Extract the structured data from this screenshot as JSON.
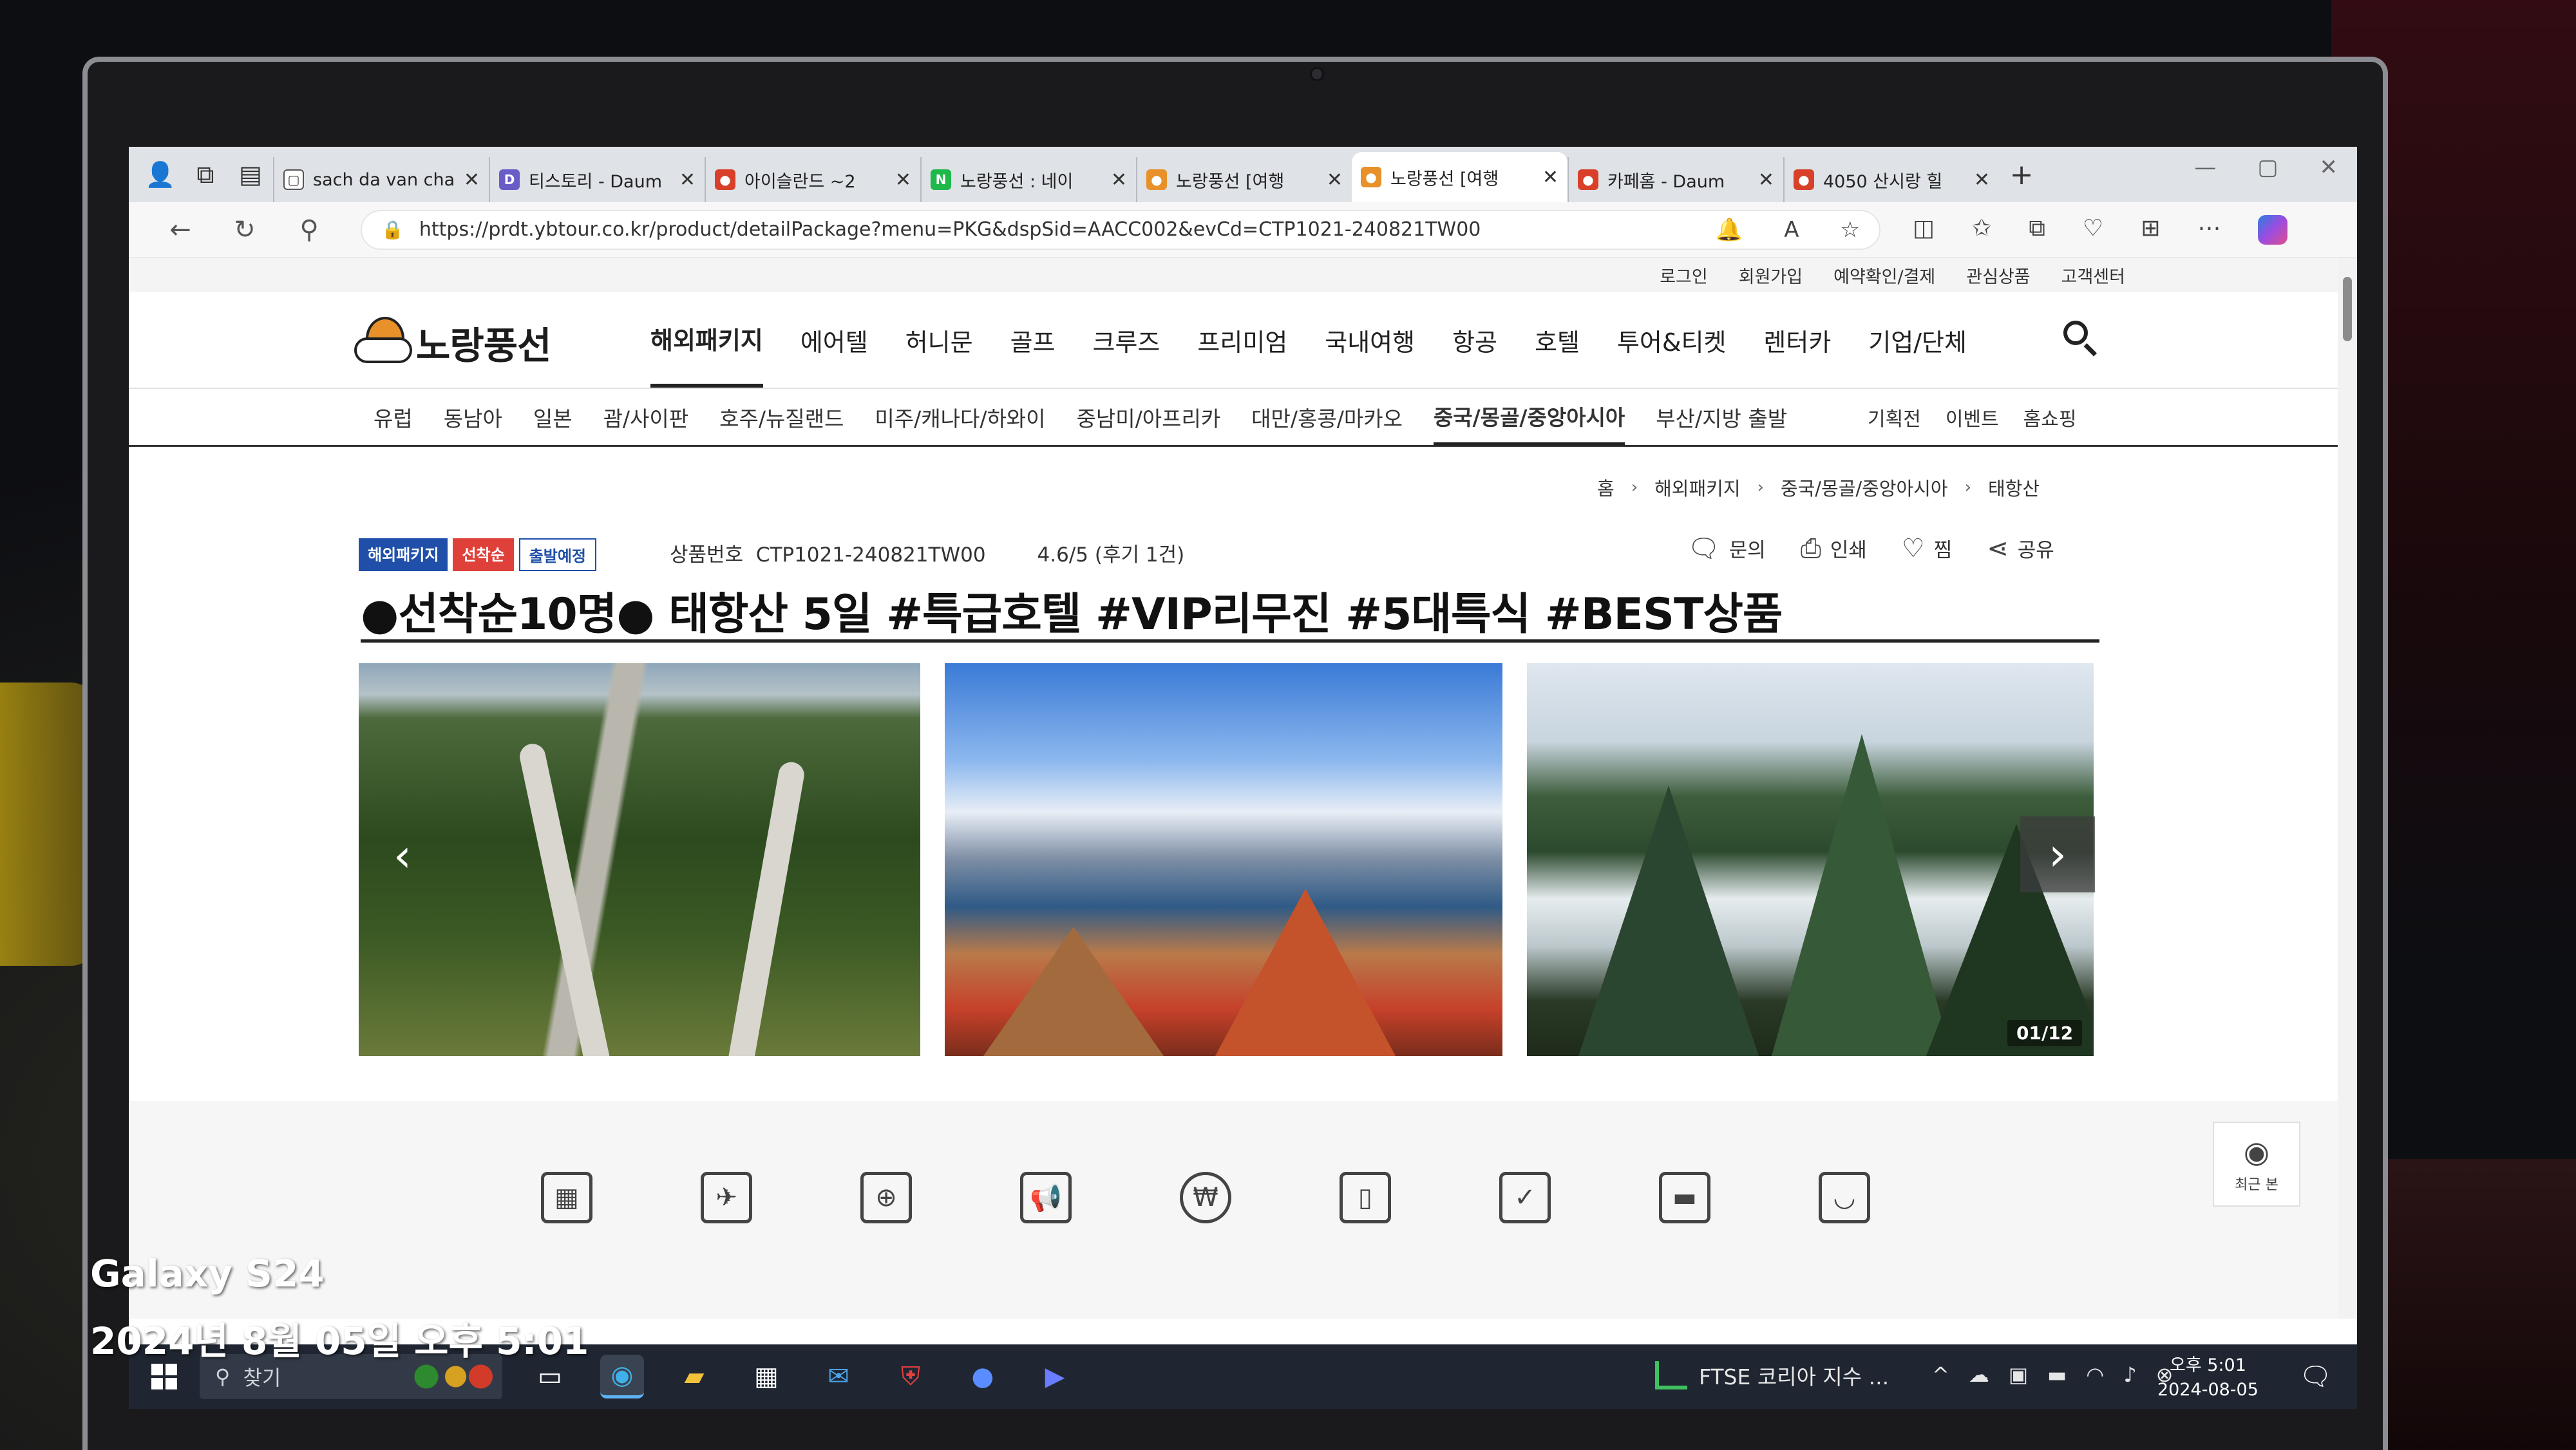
{
  "browser": {
    "tabs": [
      {
        "title": "sach da van cha",
        "fav_color": "#ffffff",
        "fav_text": "▢"
      },
      {
        "title": "티스토리 - Daum",
        "fav_color": "#6a5cc7",
        "fav_text": "D"
      },
      {
        "title": "아이슬란드 ~2",
        "fav_color": "#d8402a",
        "fav_text": "●"
      },
      {
        "title": "노랑풍선 : 네이",
        "fav_color": "#1fb84a",
        "fav_text": "N"
      },
      {
        "title": "노랑풍선 [여행",
        "fav_color": "#e8902a",
        "fav_text": "●"
      },
      {
        "title": "노랑풍선 [여행",
        "fav_color": "#e8902a",
        "fav_text": "●",
        "active": true
      },
      {
        "title": "카페홈 - Daum",
        "fav_color": "#d8402a",
        "fav_text": "●"
      },
      {
        "title": "4050 산시랑 힐",
        "fav_color": "#d8402a",
        "fav_text": "●"
      }
    ],
    "url": "https://prdt.ybtour.co.kr/product/detailPackage?menu=PKG&dspSid=AACC002&evCd=CTP1021-240821TW00"
  },
  "site": {
    "util_links": [
      "로그인",
      "회원가입",
      "예약확인/결제",
      "관심상품",
      "고객센터"
    ],
    "logo_text": "노랑풍선",
    "main_menu": [
      "해외패키지",
      "에어텔",
      "허니문",
      "골프",
      "크루즈",
      "프리미엄",
      "국내여행",
      "항공",
      "호텔",
      "투어&티켓",
      "렌터카",
      "기업/단체"
    ],
    "active_menu": 0,
    "regions": [
      "유럽",
      "동남아",
      "일본",
      "괌/사이판",
      "호주/뉴질랜드",
      "미주/캐나다/하와이",
      "중남미/아프리카",
      "대만/홍콩/마카오",
      "중국/몽골/중앙아시아",
      "부산/지방 출발"
    ],
    "active_region": 8,
    "extras": [
      "기획전",
      "이벤트",
      "홈쇼핑"
    ],
    "breadcrumb": [
      "홈",
      "해외패키지",
      "중국/몽골/중앙아시아",
      "태항산"
    ]
  },
  "product": {
    "badges": [
      {
        "label": "해외패키지",
        "color": "#1f4fa8"
      },
      {
        "label": "선착순",
        "color": "#e0403a"
      },
      {
        "label": "출발예정",
        "color": "#ffffff"
      }
    ],
    "code_label": "상품번호",
    "code": "CTP1021-240821TW00",
    "rating": "4.6/5 (후기 1건)",
    "actions": [
      {
        "label": "문의",
        "icon": "chat-icon"
      },
      {
        "label": "인쇄",
        "icon": "print-icon"
      },
      {
        "label": "찜",
        "icon": "heart-icon"
      },
      {
        "label": "공유",
        "icon": "share-icon"
      }
    ],
    "title": "●선착순10명● 태항산 5일 #특급호텔 #VIP리무진 #5대특식 #BEST상품",
    "gallery_counter": "01/12"
  },
  "quick_icons": [
    "calendar-icon",
    "airplane-icon",
    "passport-icon",
    "megaphone-icon",
    "won-icon",
    "guide-icon",
    "shield-icon",
    "bus-icon",
    "bag-icon"
  ],
  "recent_label": "최근 본",
  "taskbar": {
    "search_placeholder": "찾기",
    "news": "FTSE 코리아 지수 ...",
    "time": "오후 5:01",
    "date": "2024-08-05"
  },
  "overlay": {
    "device": "Galaxy S24",
    "timestamp": "2024년 8월 05일 오후 5:01"
  }
}
